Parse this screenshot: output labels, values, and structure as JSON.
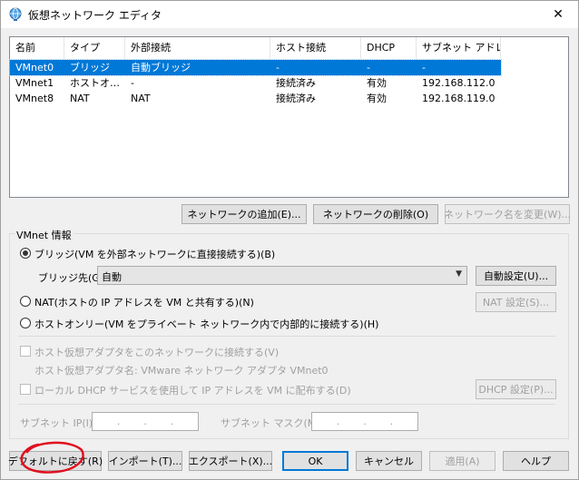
{
  "window": {
    "title": "仮想ネットワーク エディタ",
    "close": "✕"
  },
  "list": {
    "columns": [
      "名前",
      "タイプ",
      "外部接続",
      "ホスト接続",
      "DHCP",
      "サブネット アドレス"
    ],
    "rows": [
      [
        "VMnet0",
        "ブリッジ",
        "自動ブリッジ",
        "-",
        "-",
        "-"
      ],
      [
        "VMnet1",
        "ホストオ…",
        "-",
        "接続済み",
        "有効",
        "192.168.112.0"
      ],
      [
        "VMnet8",
        "NAT",
        "NAT",
        "接続済み",
        "有効",
        "192.168.119.0"
      ]
    ],
    "selected_row": 0
  },
  "list_buttons": {
    "add": "ネットワークの追加(E)...",
    "remove": "ネットワークの削除(O)",
    "rename": "ネットワーク名を変更(W)..."
  },
  "vmnet_info": {
    "group_label": "VMnet 情報",
    "bridge_radio": "ブリッジ(VM を外部ネットワークに直接接続する)(B)",
    "bridge_to_label": "ブリッジ先(G):",
    "bridge_to_value": "自動",
    "auto_settings": "自動設定(U)...",
    "nat_radio": "NAT(ホストの IP アドレスを VM と共有する)(N)",
    "nat_settings": "NAT 設定(S)...",
    "host_only_radio": "ホストオンリー(VM をプライベート ネットワーク内で内部的に接続する)(H)",
    "connect_host_adapter": "ホスト仮想アダプタをこのネットワークに接続する(V)",
    "host_adapter_name": "ホスト仮想アダプタ名: VMware ネットワーク アダプタ VMnet0",
    "use_local_dhcp": "ローカル DHCP サービスを使用して IP アドレスを VM に配布する(D)",
    "dhcp_settings": "DHCP 設定(P)...",
    "subnet_ip_label": "サブネット IP(I):",
    "subnet_mask_label": "サブネット マスク(M):",
    "ip_dot": "."
  },
  "bottom_buttons": {
    "restore_defaults": "デフォルトに戻す(R)",
    "import": "インポート(T)...",
    "export": "エクスポート(X)...",
    "ok": "OK",
    "cancel": "キャンセル",
    "apply": "適用(A)",
    "help": "ヘルプ"
  },
  "colors": {
    "selection": "#0078d7",
    "annotation": "#e0101f"
  }
}
